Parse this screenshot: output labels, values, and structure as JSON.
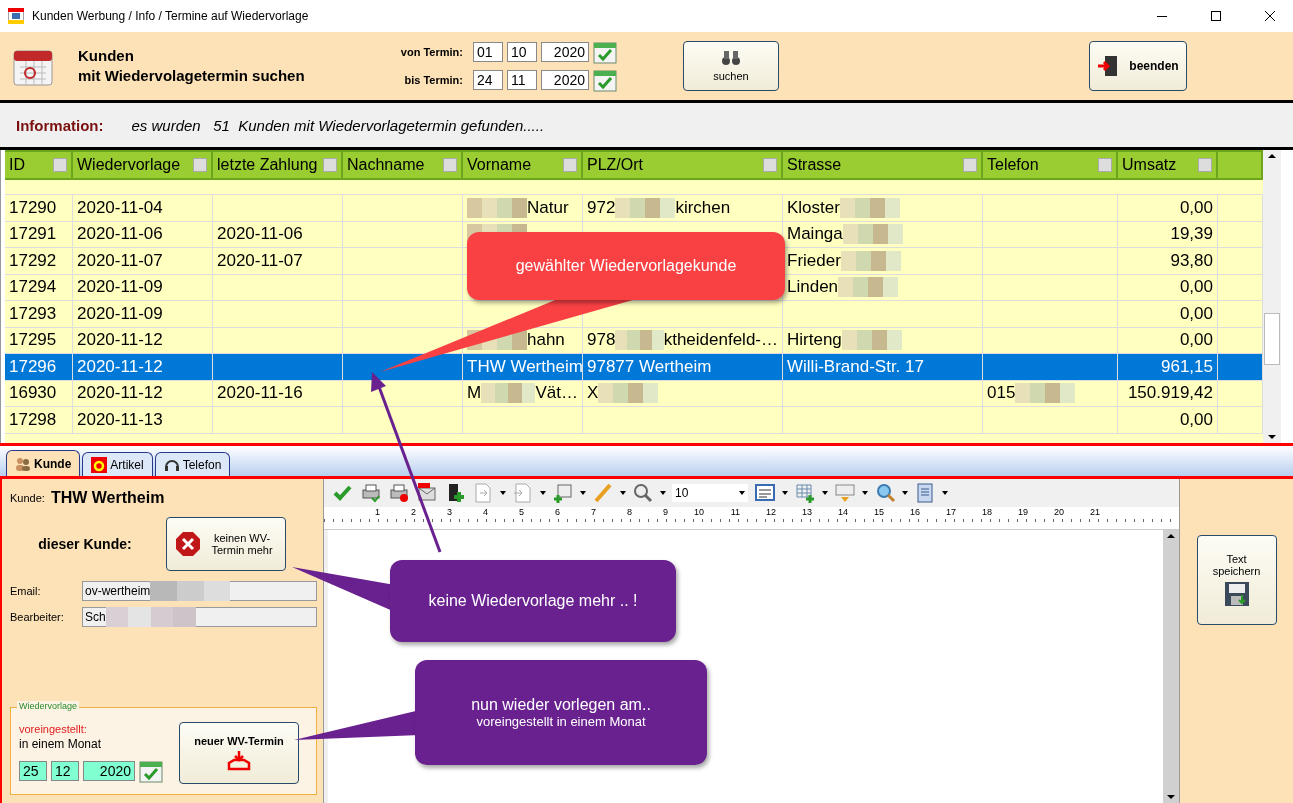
{
  "window": {
    "title": "Kunden Werbung / Info / Termine auf Wiedervorlage"
  },
  "header": {
    "title_lines": [
      "Kunden",
      "mit Wiedervolagetermin suchen"
    ],
    "from": {
      "label": "von Termin:",
      "day": "01",
      "month": "10",
      "year": "2020"
    },
    "to": {
      "label": "bis Termin:",
      "day": "24",
      "month": "11",
      "year": "2020"
    },
    "search_button": "suchen",
    "exit_button": "beenden"
  },
  "info": {
    "label": "Information:",
    "text": "es wurden   51  Kunden mit Wiedervorlagetermin gefunden....."
  },
  "table": {
    "columns": [
      "ID",
      "Wiedervorlage",
      "letzte Zahlung",
      "Nachname",
      "Vorname",
      "PLZ/Ort",
      "Strasse",
      "Telefon",
      "Umsatz"
    ],
    "rows": [
      {
        "selected": false,
        "cells": [
          "17290",
          "2020-11-04",
          null,
          null,
          {
            "segments": [
              {
                "kind": "blur"
              },
              {
                "kind": "text",
                "text": "Natur"
              }
            ]
          },
          {
            "segments": [
              {
                "kind": "text",
                "text": "972"
              },
              {
                "kind": "blur"
              },
              {
                "kind": "text",
                "text": "kirchen"
              }
            ]
          },
          {
            "segments": [
              {
                "kind": "text",
                "text": "Kloster"
              },
              {
                "kind": "blur"
              }
            ]
          },
          null,
          "0,00"
        ]
      },
      {
        "selected": false,
        "cells": [
          "17291",
          "2020-11-06",
          "2020-11-06",
          null,
          {
            "segments": [
              {
                "kind": "blur"
              }
            ]
          },
          null,
          {
            "segments": [
              {
                "kind": "text",
                "text": "Mainga"
              },
              {
                "kind": "blur"
              }
            ]
          },
          null,
          "19,39"
        ]
      },
      {
        "selected": false,
        "cells": [
          "17292",
          "2020-11-07",
          "2020-11-07",
          null,
          null,
          null,
          {
            "segments": [
              {
                "kind": "text",
                "text": "Frieder"
              },
              {
                "kind": "blur"
              }
            ]
          },
          null,
          "93,80"
        ]
      },
      {
        "selected": false,
        "cells": [
          "17294",
          "2020-11-09",
          null,
          null,
          null,
          null,
          {
            "segments": [
              {
                "kind": "text",
                "text": "Linden"
              },
              {
                "kind": "blur"
              }
            ]
          },
          null,
          "0,00"
        ]
      },
      {
        "selected": false,
        "cells": [
          "17293",
          "2020-11-09",
          null,
          null,
          null,
          null,
          null,
          null,
          "0,00"
        ]
      },
      {
        "selected": false,
        "cells": [
          "17295",
          "2020-11-12",
          null,
          null,
          {
            "segments": [
              {
                "kind": "blur"
              },
              {
                "kind": "text",
                "text": "hahn"
              }
            ]
          },
          {
            "segments": [
              {
                "kind": "text",
                "text": "978"
              },
              {
                "kind": "blur"
              },
              {
                "kind": "text",
                "text": "ktheidenfeld-…"
              }
            ]
          },
          {
            "segments": [
              {
                "kind": "text",
                "text": "Hirteng"
              },
              {
                "kind": "blur"
              }
            ]
          },
          null,
          "0,00"
        ]
      },
      {
        "selected": true,
        "cells": [
          "17296",
          "2020-11-12",
          null,
          null,
          "THW Wertheim",
          "97877 Wertheim",
          "Willi-Brand-Str. 17",
          null,
          "961,15"
        ]
      },
      {
        "selected": false,
        "cells": [
          "16930",
          "2020-11-12",
          "2020-11-16",
          null,
          {
            "segments": [
              {
                "kind": "text",
                "text": "M"
              },
              {
                "kind": "blur"
              },
              {
                "kind": "text",
                "text": "Vät…"
              }
            ]
          },
          {
            "segments": [
              {
                "kind": "text",
                "text": "X"
              },
              {
                "kind": "blur"
              }
            ]
          },
          null,
          {
            "segments": [
              {
                "kind": "text",
                "text": "015"
              },
              {
                "kind": "blur"
              }
            ]
          },
          "150.919,42"
        ]
      },
      {
        "selected": false,
        "cells": [
          "17298",
          "2020-11-13",
          null,
          null,
          null,
          null,
          null,
          null,
          "0,00"
        ]
      }
    ]
  },
  "tabs": [
    {
      "label": "Kunde",
      "selected": true
    },
    {
      "label": "Artikel",
      "selected": false
    },
    {
      "label": "Telefon",
      "selected": false
    }
  ],
  "customer": {
    "label": "Kunde:",
    "name": "THW Wertheim",
    "action_label": "dieser Kunde:",
    "no_more_button": "keinen WV-Termin mehr",
    "email": {
      "label": "Email:",
      "value": "ov-wertheim"
    },
    "editor": {
      "label": "Bearbeiter:",
      "value": "Sch"
    }
  },
  "resubmission": {
    "legend": "Wiedervorlage",
    "preset_label": "voreingestellt:",
    "preset_value": "in einem Monat",
    "day": "25",
    "month": "12",
    "year": "2020",
    "button": "neuer WV-Termin"
  },
  "editor": {
    "font_size": "10",
    "ruler": [
      "1",
      "2",
      "3",
      "4",
      "5",
      "6",
      "7",
      "8",
      "9",
      "10",
      "11",
      "12",
      "13",
      "14",
      "15",
      "16",
      "17",
      "18",
      "19",
      "20",
      "21"
    ]
  },
  "save_button": "Text speichern",
  "annotations": [
    {
      "kind": "red",
      "lines": [
        "gewählter Wiedervorlagekunde"
      ]
    },
    {
      "kind": "purple",
      "lines": [
        "keine Wiedervorlage mehr .. !"
      ]
    },
    {
      "kind": "purple",
      "lines": [
        "nun wieder vorlegen am..",
        "voreingestellt  in einem Monat"
      ]
    }
  ]
}
